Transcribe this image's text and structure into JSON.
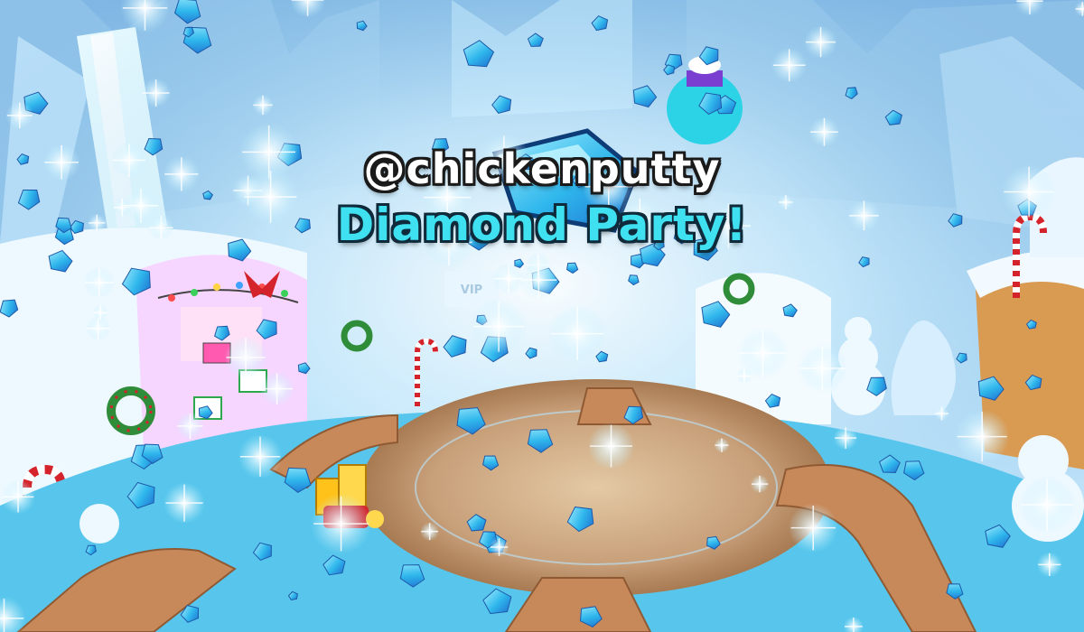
{
  "overlay": {
    "username": "@chickenputty",
    "headline": "Diamond Party!"
  },
  "scene": {
    "sign_labels": [
      "VIP"
    ]
  },
  "colors": {
    "sky": "#9fd0f2",
    "ice": "#e8f6ff",
    "water": "#4fc3ea",
    "wood": "#c8895a",
    "diamond": "#38c8f4",
    "title_cyan": "#3fe0f0"
  },
  "icons": [
    "diamond-icon",
    "sparkle-icon",
    "candy-cane-icon",
    "wreath-icon"
  ]
}
